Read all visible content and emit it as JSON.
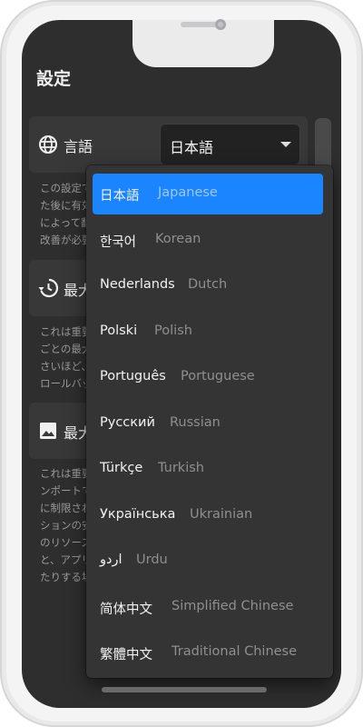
{
  "appbar": {
    "title": "設定"
  },
  "language_setting": {
    "label": "言語",
    "selected_value": "日本語",
    "icon": "globe-icon",
    "description_lines": [
      "この設定で",
      "た後に有効",
      "によって翻",
      "改善が必要"
    ]
  },
  "setting_2": {
    "label": "最大",
    "icon": "history-icon",
    "description_lines": [
      "これは重要",
      "ごとの最大",
      "さいほど、",
      "ロールバッ"
    ]
  },
  "setting_3": {
    "label": "最大",
    "icon": "image-icon",
    "description_lines": [
      "これは重要",
      "ンポートで",
      "に制限され",
      "ションの安",
      "のリソース",
      "と、アプリ",
      "たりする場"
    ]
  },
  "dropdown": {
    "options": [
      {
        "native": "日本語",
        "english": "Japanese",
        "selected": true
      },
      {
        "native": "한국어",
        "english": "Korean"
      },
      {
        "native": "Nederlands",
        "english": "Dutch"
      },
      {
        "native": "Polski",
        "english": "Polish"
      },
      {
        "native": "Português",
        "english": "Portuguese"
      },
      {
        "native": "Русский",
        "english": "Russian"
      },
      {
        "native": "Türkçe",
        "english": "Turkish"
      },
      {
        "native": "Українська",
        "english": "Ukrainian"
      },
      {
        "native": "اردو",
        "english": "Urdu"
      },
      {
        "native": "简体中文",
        "english": "Simplified Chinese"
      },
      {
        "native": "繁體中文",
        "english": "Traditional Chinese"
      }
    ]
  },
  "colors": {
    "accent": "#1a85ff",
    "background": "#2e2e2e",
    "card": "#383838"
  }
}
